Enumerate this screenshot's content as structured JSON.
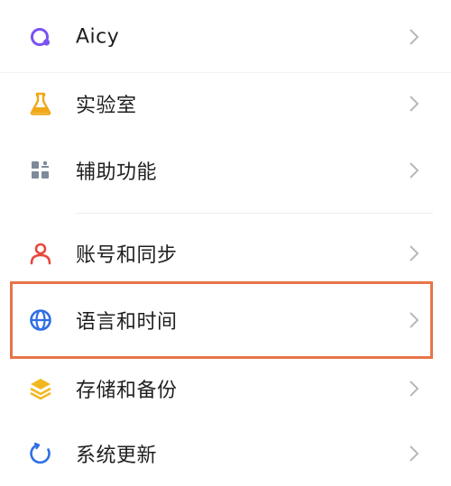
{
  "settings": {
    "items": [
      {
        "label": "Aicy",
        "icon": "aicy-icon"
      },
      {
        "label": "实验室",
        "icon": "flask-icon"
      },
      {
        "label": "辅助功能",
        "icon": "accessibility-grid-icon"
      },
      {
        "label": "账号和同步",
        "icon": "user-icon"
      },
      {
        "label": "语言和时间",
        "icon": "globe-icon"
      },
      {
        "label": "存储和备份",
        "icon": "layers-icon"
      },
      {
        "label": "系统更新",
        "icon": "update-icon"
      }
    ]
  },
  "colors": {
    "highlight": "#e8744a",
    "aicy": "#7a54f0",
    "flask": "#f0a818",
    "accessibility": "#7d8a9a",
    "user": "#e8473d",
    "globe": "#2f6fe6",
    "layers": "#f2b820",
    "update": "#2f6fe6",
    "chevron": "#b8b8b8"
  }
}
